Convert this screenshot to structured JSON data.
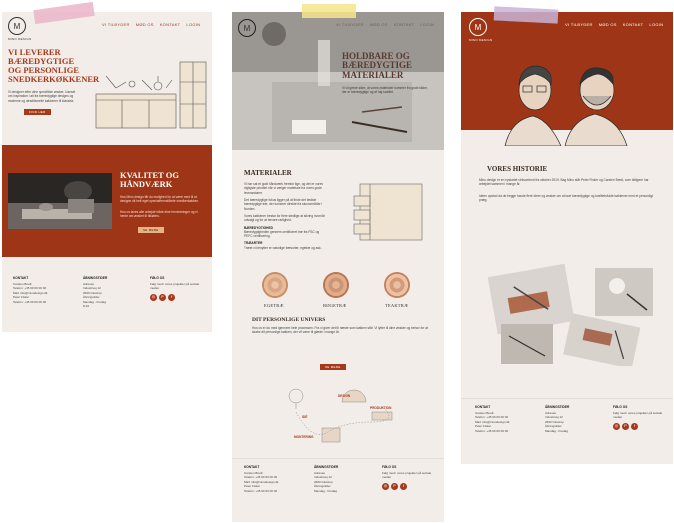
{
  "brand": {
    "logo_letter": "M",
    "logo_sub": "MINO DESIGN"
  },
  "nav": [
    "VI TILBYDER",
    "MØD OS",
    "KONTAKT",
    "LOGIN"
  ],
  "page1": {
    "hero_title": [
      "VI LEVERER",
      "BÆREDYGTIGE",
      "OG PERSONLIGE",
      "SNEDKERKØKKENER"
    ],
    "hero_text": "Vi designer efter dine specifikke ønsker. Uanset om inspiration i alt fra bæredygtige designs og moderne og utraditionelle køkkener til klassisk.",
    "hero_button": "FIND HER",
    "quality_title": [
      "KVALITET OG",
      "HÅNDVÆRK"
    ],
    "quality_text_1": "Hos Mino design får du mulighed for at være med til at designe dit helt eget specialfremstillede snedkerkøkken.",
    "quality_text_2": "Hos os laves alle arbejde både dine forventninger og vi hente om ønsket til tilkøbes.",
    "quality_button": "SE MERE"
  },
  "page2": {
    "hero_title": [
      "HOLDBARE OG",
      "BÆREDYGTIGE",
      "MATERIALER"
    ],
    "hero_text": "Vi vil gerne sikre, at vores materialer kommer fra gode kilder, der er bæredygtige og af høj kvalitet.",
    "materials_title": "MATERIALER",
    "materials_text_1": "Vi har sat et godt håndværk fremfor lige, og det er vores vigtigste prioritet når vi vælger materiale fra vores gode leverandører.",
    "materials_text_2": "Det bæredygtige fokus ligger på at finde det bedste bæredygtige træ, der kommer direkte fra skovområder i Norden.",
    "materials_text_3": "Vores køkkener bestar for flere stedlige at sikring hvornår udvalgt og for at bevare rarlighed.",
    "materials_h1": "BÆREDYGTIGHED",
    "materials_text_4": "Bæredygtigheden gennem certificeret træ fra FSC og PEFC certificering.",
    "materials_h2": "TRÆARTER",
    "materials_text_5": "Træet vi benytter er naturlige træsorter, egetræ og ask.",
    "woods": [
      "EGETRÆ",
      "BØGETRÆ",
      "TEAKTRÆ"
    ],
    "univers_title": "DIT PERSONLIGE UNIVERS",
    "univers_text": "Hos os er du med igennem hele processen. Fra vi giver det til næste som køkken står. Vi lytter til dine ønsker og behov for at skabe dit personlige køkken, der vil være til glæde i mange år.",
    "univers_button": "SE MERE",
    "process_labels": [
      "IDÉ",
      "DESIGN",
      "PRODUKTION",
      "MONTERING"
    ]
  },
  "page3": {
    "history_title": "VORES HISTORIE",
    "history_text_1": "Mino design er en nystartet virksomhed fra oktober 2019. Bag Mino står Peter Fisker og Carsten Bredt, som tidligere har arbejdet sammen i mange år.",
    "history_text_2": "Idéen opstod da de begge havde flere ideer og ønsker om at lave bæredygtige og kvalitetsfulde køkkener med et personligt præg."
  },
  "footer": {
    "col1_title": "KONTAKT",
    "col1_lines": [
      "Carsten Bredt",
      "Telefon: +45 00 00 00 00",
      "Mail: info@minodesign.dk",
      "Peter Fisker",
      "Telefon: +45 00 00 00 00"
    ],
    "col2_title": "ÅBNINGSTIDER",
    "col2_lines": [
      "Adresse",
      "Industrivej 12",
      "2600 Glostrup",
      "Åbningstider",
      "Mandag - Fredag",
      "8-16"
    ],
    "col3_title": "FØLG OS",
    "col3_text": "Følg med i vores projekter på sociale medier",
    "social_icons": [
      "instagram-icon",
      "pinterest-icon",
      "facebook-icon"
    ]
  },
  "colors": {
    "rust": "#9e3516",
    "accent": "#a7391b",
    "cream": "#f2ede8",
    "tape_pink": "#eab4c8",
    "tape_yellow": "#f6e58a",
    "tape_purple": "#c9b3d6"
  }
}
